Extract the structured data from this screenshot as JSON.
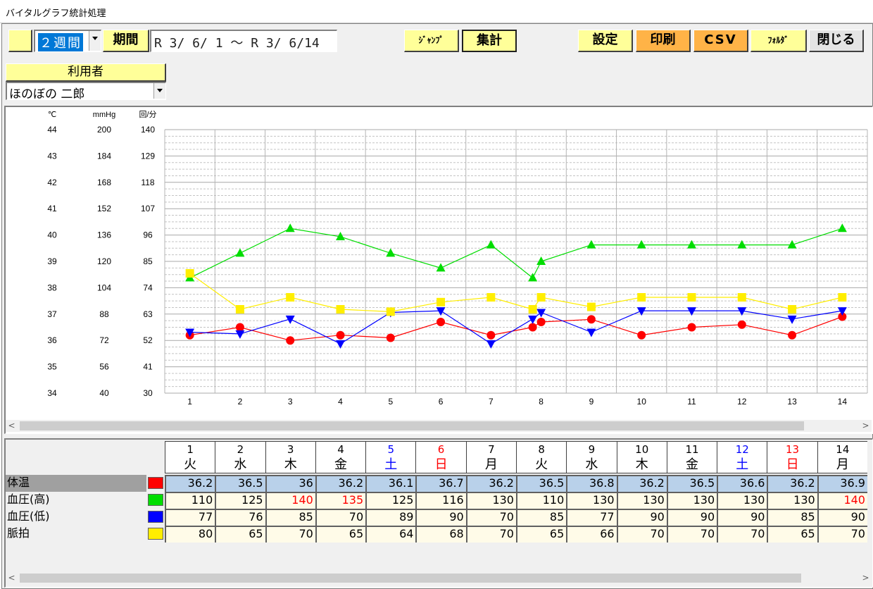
{
  "window": {
    "title": "バイタルグラフ統計処理"
  },
  "toolbar": {
    "range_select": "２週間",
    "period_label": "期間",
    "period_value": "R 3/ 6/ 1 ～ R 3/ 6/14",
    "jump_label": "ｼﾞｬﾝﾌﾟ",
    "summary_label": "集計",
    "settings_label": "設定",
    "print_label": "印刷",
    "csv_label": "CSV",
    "folder_label": "ﾌｫﾙﾀﾞ",
    "close_label": "閉じる"
  },
  "user": {
    "label": "利用者",
    "selected": "ほのぼの 二郎"
  },
  "colors": {
    "temp": "#ff0000",
    "bp_high": "#00dd00",
    "bp_low": "#0000ff",
    "pulse": "#ffee00",
    "saturday": "#0000ff",
    "sunday": "#ff0000",
    "alert": "#ff0000"
  },
  "chart_data": {
    "type": "line",
    "x": [
      1,
      2,
      3,
      4,
      5,
      6,
      7,
      8,
      9,
      10,
      11,
      12,
      13,
      14
    ],
    "axes": {
      "temperature": {
        "unit": "℃",
        "ticks": [
          44,
          43,
          42,
          41,
          40,
          39,
          38,
          37,
          36,
          35,
          34
        ],
        "range": [
          34,
          44
        ]
      },
      "blood_pressure": {
        "unit": "mmHg",
        "ticks": [
          200,
          184,
          168,
          152,
          136,
          120,
          104,
          88,
          72,
          56,
          40
        ],
        "range": [
          40,
          200
        ]
      },
      "pulse": {
        "unit": "回/分",
        "ticks": [
          140,
          129,
          118,
          107,
          96,
          85,
          74,
          63,
          52,
          41,
          30
        ],
        "range": [
          30,
          140
        ]
      }
    },
    "grid": true,
    "series": [
      {
        "name": "体温",
        "axis": "temperature",
        "color": "#ff0000",
        "marker": "circle",
        "values": [
          36.2,
          36.5,
          36,
          36.2,
          36.1,
          36.7,
          36.2,
          36.5,
          36.8,
          36.2,
          36.5,
          36.6,
          36.2,
          36.9
        ]
      },
      {
        "name": "血圧(高)",
        "axis": "blood_pressure",
        "color": "#00dd00",
        "marker": "triangle-up",
        "values": [
          110,
          125,
          140,
          135,
          125,
          116,
          130,
          110,
          130,
          130,
          130,
          130,
          130,
          140
        ]
      },
      {
        "name": "血圧(低)",
        "axis": "blood_pressure",
        "color": "#0000ff",
        "marker": "triangle-down",
        "values": [
          77,
          76,
          85,
          70,
          89,
          90,
          70,
          85,
          77,
          90,
          90,
          90,
          85,
          90
        ]
      },
      {
        "name": "脈拍",
        "axis": "pulse",
        "color": "#ffee00",
        "marker": "square",
        "values": [
          80,
          65,
          70,
          65,
          64,
          68,
          70,
          65,
          66,
          70,
          70,
          70,
          65,
          70
        ]
      }
    ],
    "chart_points": [
      {
        "day": 8,
        "series": "血圧(高)",
        "value": 120
      },
      {
        "day": 8,
        "series": "血圧(低)",
        "value": 89
      },
      {
        "day": 8,
        "series": "体温",
        "value": 36.7
      },
      {
        "day": 8,
        "series": "脈拍",
        "value": 70
      }
    ]
  },
  "table": {
    "days": [
      "1",
      "2",
      "3",
      "4",
      "5",
      "6",
      "7",
      "8",
      "9",
      "10",
      "11",
      "12",
      "13",
      "14"
    ],
    "weekdays": [
      "火",
      "水",
      "木",
      "金",
      "土",
      "日",
      "月",
      "火",
      "水",
      "木",
      "金",
      "土",
      "日",
      "月"
    ],
    "day_colors": [
      "normal",
      "normal",
      "normal",
      "normal",
      "saturday",
      "sunday",
      "normal",
      "normal",
      "normal",
      "normal",
      "normal",
      "saturday",
      "sunday",
      "normal"
    ],
    "rows": [
      {
        "label": "体温",
        "color": "#ff0000",
        "values": [
          "36.2",
          "36.5",
          "36",
          "36.2",
          "36.1",
          "36.7",
          "36.2",
          "36.5",
          "36.8",
          "36.2",
          "36.5",
          "36.6",
          "36.2",
          "36.9"
        ],
        "alerts": []
      },
      {
        "label": "血圧(高)",
        "color": "#00dd00",
        "values": [
          "110",
          "125",
          "140",
          "135",
          "125",
          "116",
          "130",
          "110",
          "130",
          "130",
          "130",
          "130",
          "130",
          "140"
        ],
        "alerts": [
          2,
          3,
          13
        ]
      },
      {
        "label": "血圧(低)",
        "color": "#0000ff",
        "values": [
          "77",
          "76",
          "85",
          "70",
          "89",
          "90",
          "70",
          "85",
          "77",
          "90",
          "90",
          "90",
          "85",
          "90"
        ],
        "alerts": []
      },
      {
        "label": "脈拍",
        "color": "#ffee00",
        "values": [
          "80",
          "65",
          "70",
          "65",
          "64",
          "68",
          "70",
          "65",
          "66",
          "70",
          "70",
          "70",
          "65",
          "70"
        ],
        "alerts": []
      }
    ]
  }
}
